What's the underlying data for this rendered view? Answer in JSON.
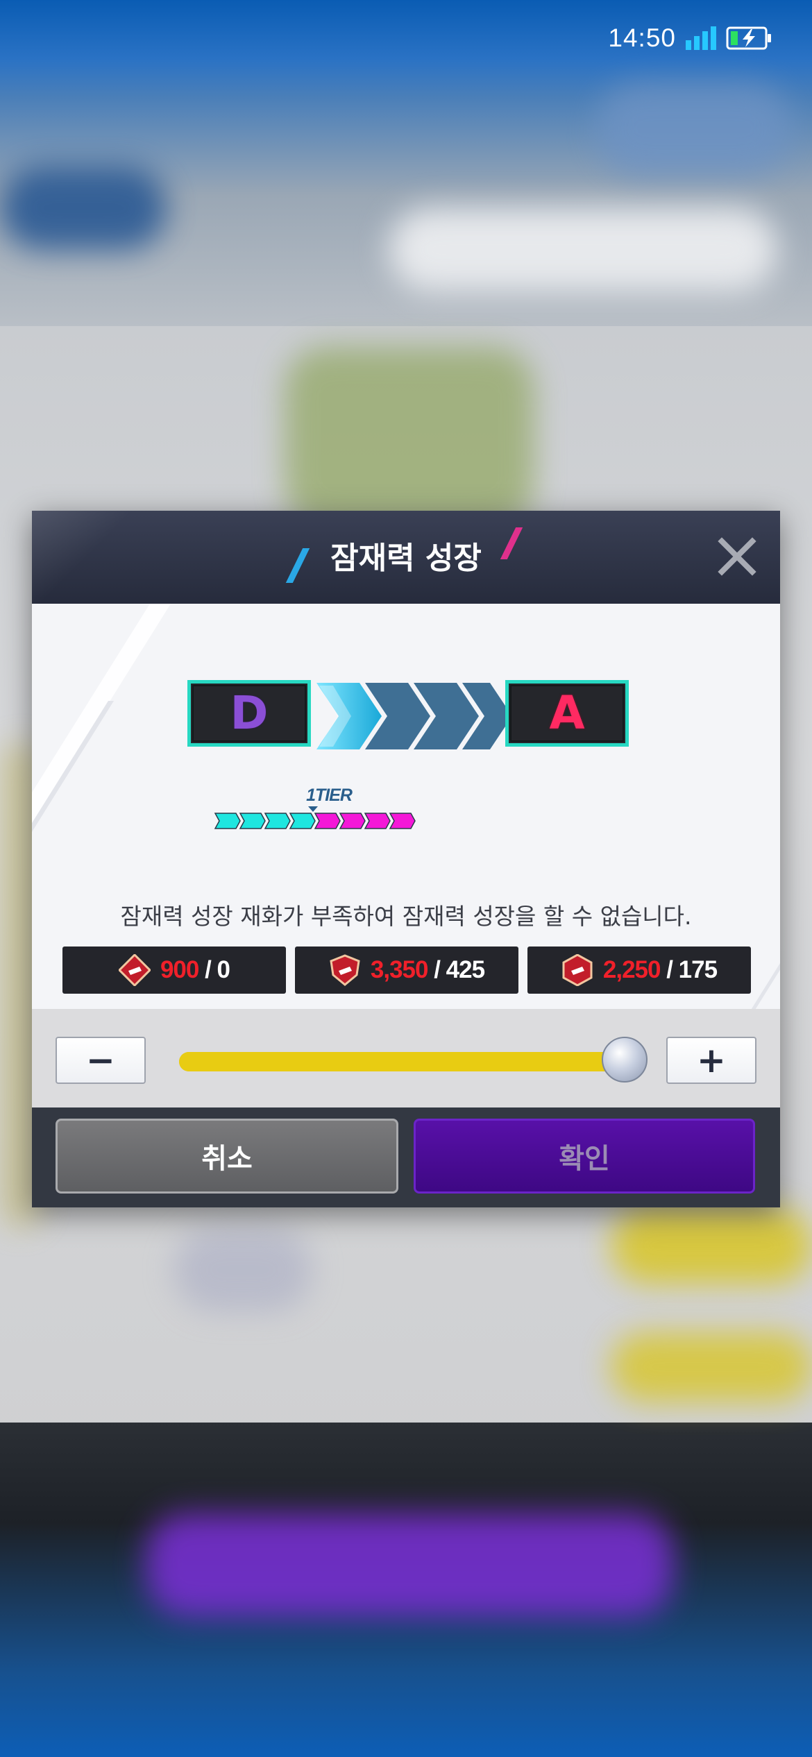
{
  "status_bar": {
    "time": "14:50",
    "signal_icon": "signal-icon",
    "battery_icon": "battery-charging-icon"
  },
  "dialog": {
    "title": "잠재력 성장",
    "close_icon": "close-icon",
    "grade_from": "D",
    "grade_to": "A",
    "tier_label": "1TIER",
    "tier_progress": {
      "total_segments": 8,
      "filled_cyan": 4,
      "current_marker_after": 4
    },
    "warning": "잠재력 성장 재화가 부족하여 잠재력 성장을 할 수 없습니다.",
    "resources": [
      {
        "icon": "diamond-chip-icon",
        "required": "900",
        "owned": "/ 0"
      },
      {
        "icon": "shield-chip-icon",
        "required": "3,350",
        "owned": "/ 425"
      },
      {
        "icon": "hexagon-chip-icon",
        "required": "2,250",
        "owned": "/ 175"
      }
    ],
    "slider": {
      "minus_label": "−",
      "plus_label": "+",
      "value_fraction": 1.0
    },
    "cancel_label": "취소",
    "confirm_label": "확인"
  },
  "colors": {
    "accent_cyan": "#27d8c2",
    "required_red": "#f0202a",
    "slider_yellow": "#e8cc12",
    "confirm_purple": "#4a0c96",
    "grade_d": "#8b4fd6",
    "grade_a": "#ff2a62"
  }
}
